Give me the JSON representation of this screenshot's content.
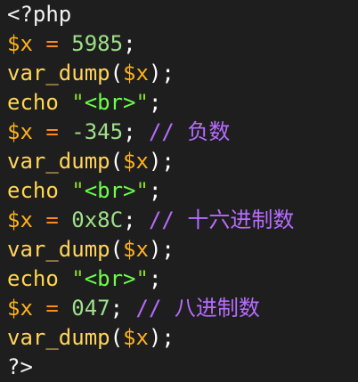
{
  "colors": {
    "background": "#1e1e1e",
    "variable": "#ffb31a",
    "operator": "#ff8a1c",
    "number": "#9fe08a",
    "function": "#ffd45a",
    "keyword": "#ffd54d",
    "string": "#6cff4a",
    "comment": "#b66cff"
  },
  "code": {
    "lines": [
      {
        "tokens": [
          {
            "t": "plain",
            "v": "<?php"
          }
        ]
      },
      {
        "tokens": [
          {
            "t": "var",
            "v": "$x"
          },
          {
            "t": "plain",
            "v": " "
          },
          {
            "t": "op",
            "v": "="
          },
          {
            "t": "plain",
            "v": " "
          },
          {
            "t": "num",
            "v": "5985"
          },
          {
            "t": "punc",
            "v": ";"
          }
        ]
      },
      {
        "tokens": [
          {
            "t": "func",
            "v": "var_dump"
          },
          {
            "t": "punc",
            "v": "("
          },
          {
            "t": "var",
            "v": "$x"
          },
          {
            "t": "punc",
            "v": ");"
          }
        ]
      },
      {
        "tokens": [
          {
            "t": "kw",
            "v": "echo"
          },
          {
            "t": "plain",
            "v": " "
          },
          {
            "t": "str-q",
            "v": "\""
          },
          {
            "t": "str",
            "v": "<br>"
          },
          {
            "t": "str-q",
            "v": "\""
          },
          {
            "t": "punc",
            "v": ";"
          }
        ]
      },
      {
        "tokens": [
          {
            "t": "var",
            "v": "$x"
          },
          {
            "t": "plain",
            "v": " "
          },
          {
            "t": "op",
            "v": "="
          },
          {
            "t": "plain",
            "v": " "
          },
          {
            "t": "num",
            "v": "-345"
          },
          {
            "t": "punc",
            "v": ";"
          },
          {
            "t": "plain",
            "v": " "
          },
          {
            "t": "comment",
            "v": "// 负数"
          }
        ]
      },
      {
        "tokens": [
          {
            "t": "func",
            "v": "var_dump"
          },
          {
            "t": "punc",
            "v": "("
          },
          {
            "t": "var",
            "v": "$x"
          },
          {
            "t": "punc",
            "v": ");"
          }
        ]
      },
      {
        "tokens": [
          {
            "t": "kw",
            "v": "echo"
          },
          {
            "t": "plain",
            "v": " "
          },
          {
            "t": "str-q",
            "v": "\""
          },
          {
            "t": "str",
            "v": "<br>"
          },
          {
            "t": "str-q",
            "v": "\""
          },
          {
            "t": "punc",
            "v": ";"
          }
        ]
      },
      {
        "tokens": [
          {
            "t": "var",
            "v": "$x"
          },
          {
            "t": "plain",
            "v": " "
          },
          {
            "t": "op",
            "v": "="
          },
          {
            "t": "plain",
            "v": " "
          },
          {
            "t": "num",
            "v": "0x8C"
          },
          {
            "t": "punc",
            "v": ";"
          },
          {
            "t": "plain",
            "v": " "
          },
          {
            "t": "comment",
            "v": "// 十六进制数"
          }
        ]
      },
      {
        "tokens": [
          {
            "t": "func",
            "v": "var_dump"
          },
          {
            "t": "punc",
            "v": "("
          },
          {
            "t": "var",
            "v": "$x"
          },
          {
            "t": "punc",
            "v": ");"
          }
        ]
      },
      {
        "tokens": [
          {
            "t": "kw",
            "v": "echo"
          },
          {
            "t": "plain",
            "v": " "
          },
          {
            "t": "str-q",
            "v": "\""
          },
          {
            "t": "str",
            "v": "<br>"
          },
          {
            "t": "str-q",
            "v": "\""
          },
          {
            "t": "punc",
            "v": ";"
          }
        ]
      },
      {
        "tokens": [
          {
            "t": "var",
            "v": "$x"
          },
          {
            "t": "plain",
            "v": " "
          },
          {
            "t": "op",
            "v": "="
          },
          {
            "t": "plain",
            "v": " "
          },
          {
            "t": "num",
            "v": "047"
          },
          {
            "t": "punc",
            "v": ";"
          },
          {
            "t": "plain",
            "v": " "
          },
          {
            "t": "comment",
            "v": "// 八进制数"
          }
        ]
      },
      {
        "tokens": [
          {
            "t": "func",
            "v": "var_dump"
          },
          {
            "t": "punc",
            "v": "("
          },
          {
            "t": "var",
            "v": "$x"
          },
          {
            "t": "punc",
            "v": ");"
          }
        ]
      },
      {
        "tokens": [
          {
            "t": "plain",
            "v": "?>"
          }
        ]
      }
    ]
  }
}
